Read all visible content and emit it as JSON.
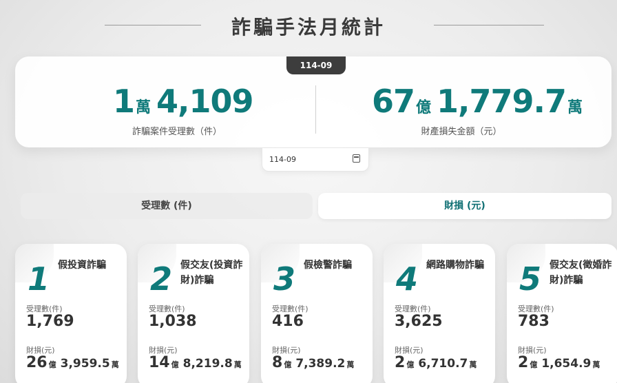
{
  "page": {
    "title": "詐騙手法月統計",
    "period": "114-09"
  },
  "summary": {
    "cases": {
      "a": "1",
      "a_unit": "萬",
      "b": "4,109",
      "label": "詐騙案件受理數（件）"
    },
    "loss": {
      "a": "67",
      "a_unit": "億",
      "b": "1,779.7",
      "b_unit": "萬",
      "label": "財產損失金額（元）"
    }
  },
  "date_picker": {
    "value": "114-09",
    "icon": "calendar-icon"
  },
  "tabs": [
    {
      "label": "受理數 (件)",
      "active": false
    },
    {
      "label": "財損 (元)",
      "active": true
    }
  ],
  "colors": {
    "accent": "#0f7a7a",
    "badge": "#3d3d3d"
  },
  "card_labels": {
    "count": "受理數(件)",
    "loss": "財損(元)"
  },
  "cards": [
    {
      "rank": "1",
      "name": "假投資詐騙",
      "count": "1,769",
      "loss_a": "26",
      "loss_a_unit": "億",
      "loss_b": "3,959.5",
      "loss_b_unit": "萬"
    },
    {
      "rank": "2",
      "name": "假交友(投資詐財)詐騙",
      "count": "1,038",
      "loss_a": "14",
      "loss_a_unit": "億",
      "loss_b": "8,219.8",
      "loss_b_unit": "萬"
    },
    {
      "rank": "3",
      "name": "假檢警詐騙",
      "count": "416",
      "loss_a": "8",
      "loss_a_unit": "億",
      "loss_b": "7,389.2",
      "loss_b_unit": "萬"
    },
    {
      "rank": "4",
      "name": "網路購物詐騙",
      "count": "3,625",
      "loss_a": "2",
      "loss_a_unit": "億",
      "loss_b": "6,710.7",
      "loss_b_unit": "萬"
    },
    {
      "rank": "5",
      "name": "假交友(徵婚詐財)詐騙",
      "count": "783",
      "loss_a": "2",
      "loss_a_unit": "億",
      "loss_b": "1,654.9",
      "loss_b_unit": "萬"
    }
  ]
}
